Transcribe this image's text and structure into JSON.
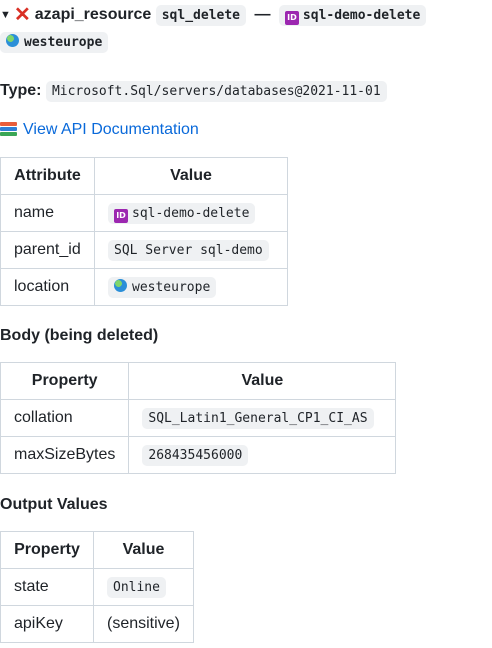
{
  "summary": {
    "resource_type": "azapi_resource",
    "resource_name": "sql_delete",
    "separator": "—",
    "display_name": "sql-demo-delete",
    "location": "westeurope"
  },
  "type_line": {
    "label": "Type:",
    "value": "Microsoft.Sql/servers/databases@2021-11-01"
  },
  "docs": {
    "link_text": "View API Documentation"
  },
  "attributes_table": {
    "headers": [
      "Attribute",
      "Value"
    ],
    "rows": [
      {
        "attr": "name",
        "value": "sql-demo-delete"
      },
      {
        "attr": "parent_id",
        "value": "SQL Server sql-demo"
      },
      {
        "attr": "location",
        "value": "westeurope"
      }
    ]
  },
  "body_section": {
    "heading": "Body (being deleted)",
    "headers": [
      "Property",
      "Value"
    ],
    "rows": [
      {
        "prop": "collation",
        "value": "SQL_Latin1_General_CP1_CI_AS"
      },
      {
        "prop": "maxSizeBytes",
        "value": "268435456000"
      }
    ]
  },
  "output_section": {
    "heading": "Output Values",
    "headers": [
      "Property",
      "Value"
    ],
    "rows": [
      {
        "prop": "state",
        "value": "Online"
      },
      {
        "prop": "apiKey",
        "value": "(sensitive)"
      }
    ]
  },
  "icons": {
    "disclosure": "triangle-down-icon",
    "status": "red-x-icon",
    "id": "id-badge-icon",
    "globe": "globe-icon",
    "docs": "books-icon"
  },
  "colors": {
    "status_red": "#d93025",
    "link": "#0969da",
    "id_badge": "#9c27b0"
  }
}
